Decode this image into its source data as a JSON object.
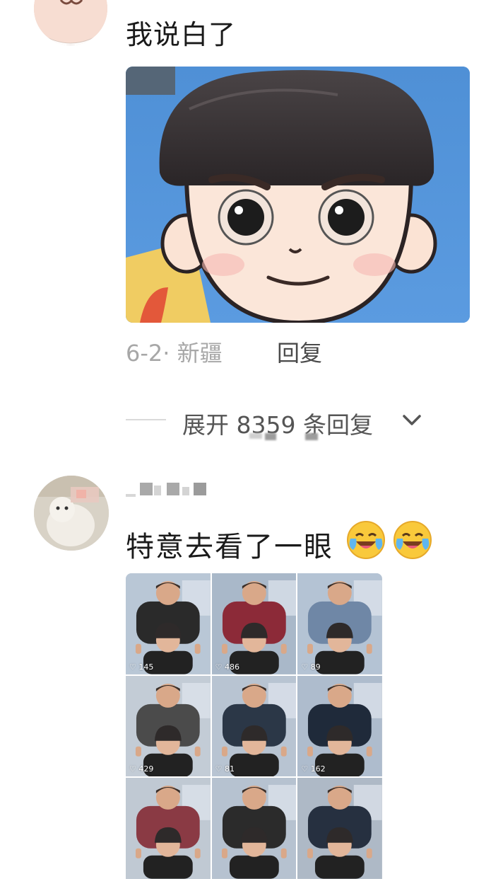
{
  "comment1": {
    "text": "我说白了",
    "meta": "6-2· 新疆",
    "reply_label": "回复"
  },
  "thread": {
    "expand_label": "展开 8359 条回复"
  },
  "comment2": {
    "text": "特意去看了一眼",
    "emoji": [
      "crying-laughing-emoji",
      "crying-laughing-emoji"
    ],
    "grid": {
      "cells": [
        {
          "count": "145"
        },
        {
          "count": "486"
        },
        {
          "count": "89"
        },
        {
          "count": "429"
        },
        {
          "count": "81"
        },
        {
          "count": "162"
        },
        {
          "count": ""
        },
        {
          "count": ""
        },
        {
          "count": ""
        }
      ]
    }
  },
  "colors": {
    "meta_gray": "#a7a7a7",
    "reply_gray": "#4a4a4a",
    "text_dark": "#1a1a1a"
  }
}
